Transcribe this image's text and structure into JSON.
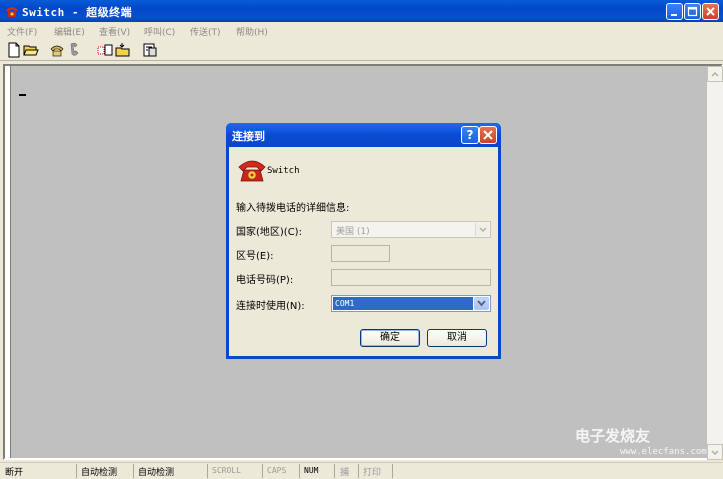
{
  "window": {
    "title": "Switch - 超级终端",
    "minimize_label": "_",
    "maximize_label": "□",
    "close_label": "×"
  },
  "menu": {
    "items": [
      {
        "label": "文件(F)"
      },
      {
        "label": "编辑(E)"
      },
      {
        "label": "查看(V)"
      },
      {
        "label": "呼叫(C)"
      },
      {
        "label": "传送(T)"
      },
      {
        "label": "帮助(H)"
      }
    ]
  },
  "toolbar": {
    "icons": [
      "new-icon",
      "open-icon",
      "connect-icon",
      "disconnect-icon",
      "send-icon",
      "receive-icon",
      "properties-icon"
    ]
  },
  "dialog": {
    "title": "连接到",
    "help_label": "?",
    "close_label": "×",
    "connection_name": "Switch",
    "prompt": "输入待拨电话的详细信息:",
    "country_label": "国家(地区)(C):",
    "country_value": "美国 (1)",
    "area_label": "区号(E):",
    "area_value": "",
    "phone_label": "电话号码(P):",
    "phone_value": "",
    "connect_using_label": "连接时使用(N):",
    "connect_using_value": "COM1",
    "ok_label": "确定",
    "cancel_label": "取消"
  },
  "status": {
    "connection": "断开",
    "detect1": "自动检测",
    "detect2": "自动检测",
    "scroll": "SCROLL",
    "caps": "CAPS",
    "num": "NUM",
    "capture": "捕",
    "print": "打印"
  },
  "watermark": {
    "text": "电子发烧友",
    "url": "www.elecfans.com"
  }
}
